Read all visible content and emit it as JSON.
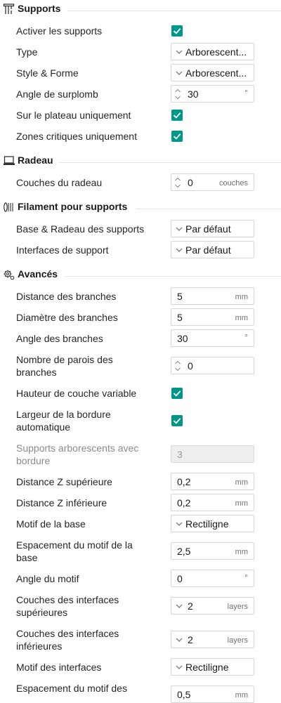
{
  "sections": {
    "supports": {
      "title": "Supports",
      "icon": "supports-icon"
    },
    "radeau": {
      "title": "Radeau",
      "icon": "raft-icon"
    },
    "filament": {
      "title": "Filament pour supports",
      "icon": "filament-icon"
    },
    "avances": {
      "title": "Avancés",
      "icon": "gear-icon"
    }
  },
  "rows": {
    "activer_supports": {
      "label": "Activer les supports",
      "checked": true
    },
    "type": {
      "label": "Type",
      "value": "Arborescent..."
    },
    "style_forme": {
      "label": "Style & Forme",
      "value": "Arborescent..."
    },
    "angle_surplomb": {
      "label": "Angle de surplomb",
      "value": "30",
      "unit": "°"
    },
    "sur_plateau": {
      "label": "Sur le plateau uniquement",
      "checked": true
    },
    "zones_critiques": {
      "label": "Zones critiques uniquement",
      "checked": true
    },
    "couches_radeau": {
      "label": "Couches du radeau",
      "value": "0",
      "unit": "couches"
    },
    "base_radeau_supports": {
      "label": "Base & Radeau des supports",
      "value": "Par défaut"
    },
    "interfaces_support": {
      "label": "Interfaces de support",
      "value": "Par défaut"
    },
    "distance_branches": {
      "label": "Distance des branches",
      "value": "5",
      "unit": "mm"
    },
    "diametre_branches": {
      "label": "Diamètre des branches",
      "value": "5",
      "unit": "mm"
    },
    "angle_branches": {
      "label": "Angle des branches",
      "value": "30",
      "unit": "°"
    },
    "parois_branches": {
      "label_line1": "Nombre de parois des",
      "label_line2": "branches",
      "value": "0"
    },
    "hauteur_couche_variable": {
      "label": "Hauteur de couche variable",
      "checked": true
    },
    "largeur_bordure": {
      "label_line1": "Largeur de la bordure",
      "label_line2": "automatique",
      "checked": true
    },
    "supports_bordure": {
      "label_line1": "Supports arborescents avec",
      "label_line2": "bordure",
      "value": "3"
    },
    "distance_z_sup": {
      "label": "Distance Z supérieure",
      "value": "0,2",
      "unit": "mm"
    },
    "distance_z_inf": {
      "label": "Distance Z inférieure",
      "value": "0,2",
      "unit": "mm"
    },
    "motif_base": {
      "label": "Motif de la base",
      "value": "Rectiligne"
    },
    "espacement_motif_base": {
      "label_line1": "Espacement du motif de la",
      "label_line2": "base",
      "value": "2,5",
      "unit": "mm"
    },
    "angle_motif": {
      "label": "Angle du motif",
      "value": "0",
      "unit": "°"
    },
    "couches_interfaces_sup": {
      "label_line1": "Couches des interfaces",
      "label_line2": "supérieures",
      "value": "2",
      "unit": "layers"
    },
    "couches_interfaces_inf": {
      "label_line1": "Couches des interfaces",
      "label_line2": "inférieures",
      "value": "2",
      "unit": "layers"
    },
    "motif_interfaces": {
      "label": "Motif des interfaces",
      "value": "Rectiligne"
    },
    "espacement_motif_interfaces": {
      "label": "Espacement du motif des",
      "value": "0,5",
      "unit": "mm"
    }
  },
  "colors": {
    "accent": "#009688",
    "divider": "#e3e3e3",
    "border": "#d6d6d6"
  }
}
